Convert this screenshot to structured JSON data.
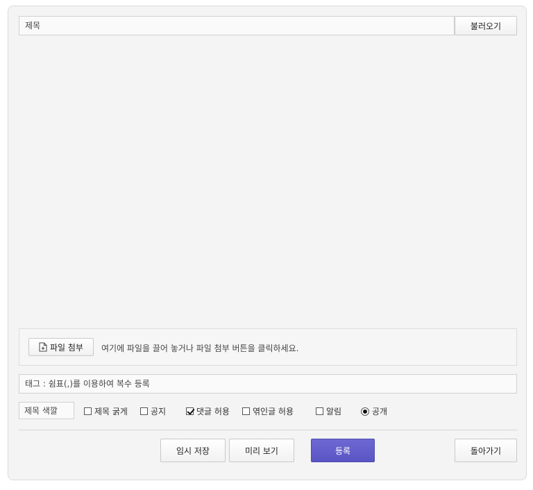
{
  "header": {
    "title_placeholder": "제목",
    "load_button": "불러오기"
  },
  "attachment": {
    "button_label": "파일 첨부",
    "hint": "여기에 파일을 끌어 놓거나 파일 첨부 버튼을 클릭하세요.",
    "icon": "file-add-icon"
  },
  "tags": {
    "placeholder": "태그 : 쉼표(,)를 이용하여 복수 등록"
  },
  "options": {
    "title_color_label": "제목 색깔",
    "items": [
      {
        "label": "제목 굵게",
        "type": "checkbox",
        "checked": false
      },
      {
        "label": "공지",
        "type": "checkbox",
        "checked": false
      },
      {
        "label": "댓글 허용",
        "type": "checkbox",
        "checked": true
      },
      {
        "label": "엮인글 허용",
        "type": "checkbox",
        "checked": false
      },
      {
        "label": "알림",
        "type": "checkbox",
        "checked": false
      },
      {
        "label": "공개",
        "type": "radio",
        "checked": true
      }
    ]
  },
  "footer": {
    "temp_save": "임시 저장",
    "preview": "미리 보기",
    "submit": "등록",
    "back": "돌아가기"
  },
  "colors": {
    "submit_bg": "#5f5ac8",
    "panel_bg": "#f4f4f4"
  }
}
